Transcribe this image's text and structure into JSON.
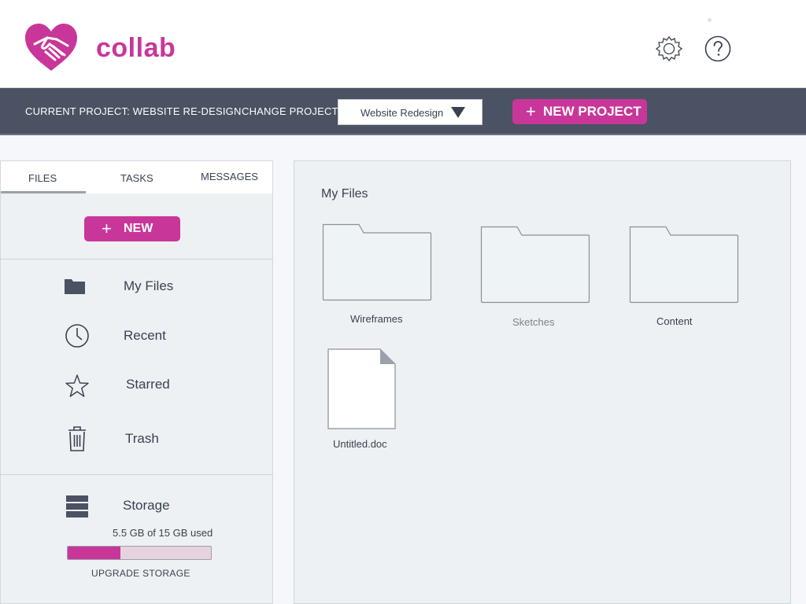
{
  "app": {
    "name": "collab",
    "brand_color": "#c93699"
  },
  "header": {
    "settings_icon": "gear-icon",
    "help_icon": "question-circle-icon"
  },
  "project_bar": {
    "current_project_label": "CURRENT PROJECT: WEBSITE RE-DESIGN",
    "change_project_label": "CHANGE PROJECT:",
    "selected_project": "Website Redesign",
    "new_project_button": "NEW PROJECT"
  },
  "sidebar": {
    "tabs": [
      {
        "label": "FILES",
        "active": true
      },
      {
        "label": "TASKS",
        "active": false
      },
      {
        "label": "MESSAGES",
        "active": false
      }
    ],
    "new_button": "NEW",
    "items": [
      {
        "label": "My Files",
        "icon": "folder-icon"
      },
      {
        "label": "Recent",
        "icon": "clock-icon"
      },
      {
        "label": "Starred",
        "icon": "star-icon"
      },
      {
        "label": "Trash",
        "icon": "trash-icon"
      }
    ],
    "storage": {
      "label": "Storage",
      "usage_text": "5.5 GB of 15 GB used",
      "used_gb": 5.5,
      "total_gb": 15,
      "upgrade_label": "UPGRADE STORAGE"
    }
  },
  "main": {
    "title": "My Files",
    "folders": [
      {
        "name": "Wireframes"
      },
      {
        "name": "Sketches"
      },
      {
        "name": "Content"
      }
    ],
    "files": [
      {
        "name": "Untitled.doc",
        "icon": "document-icon"
      }
    ]
  }
}
